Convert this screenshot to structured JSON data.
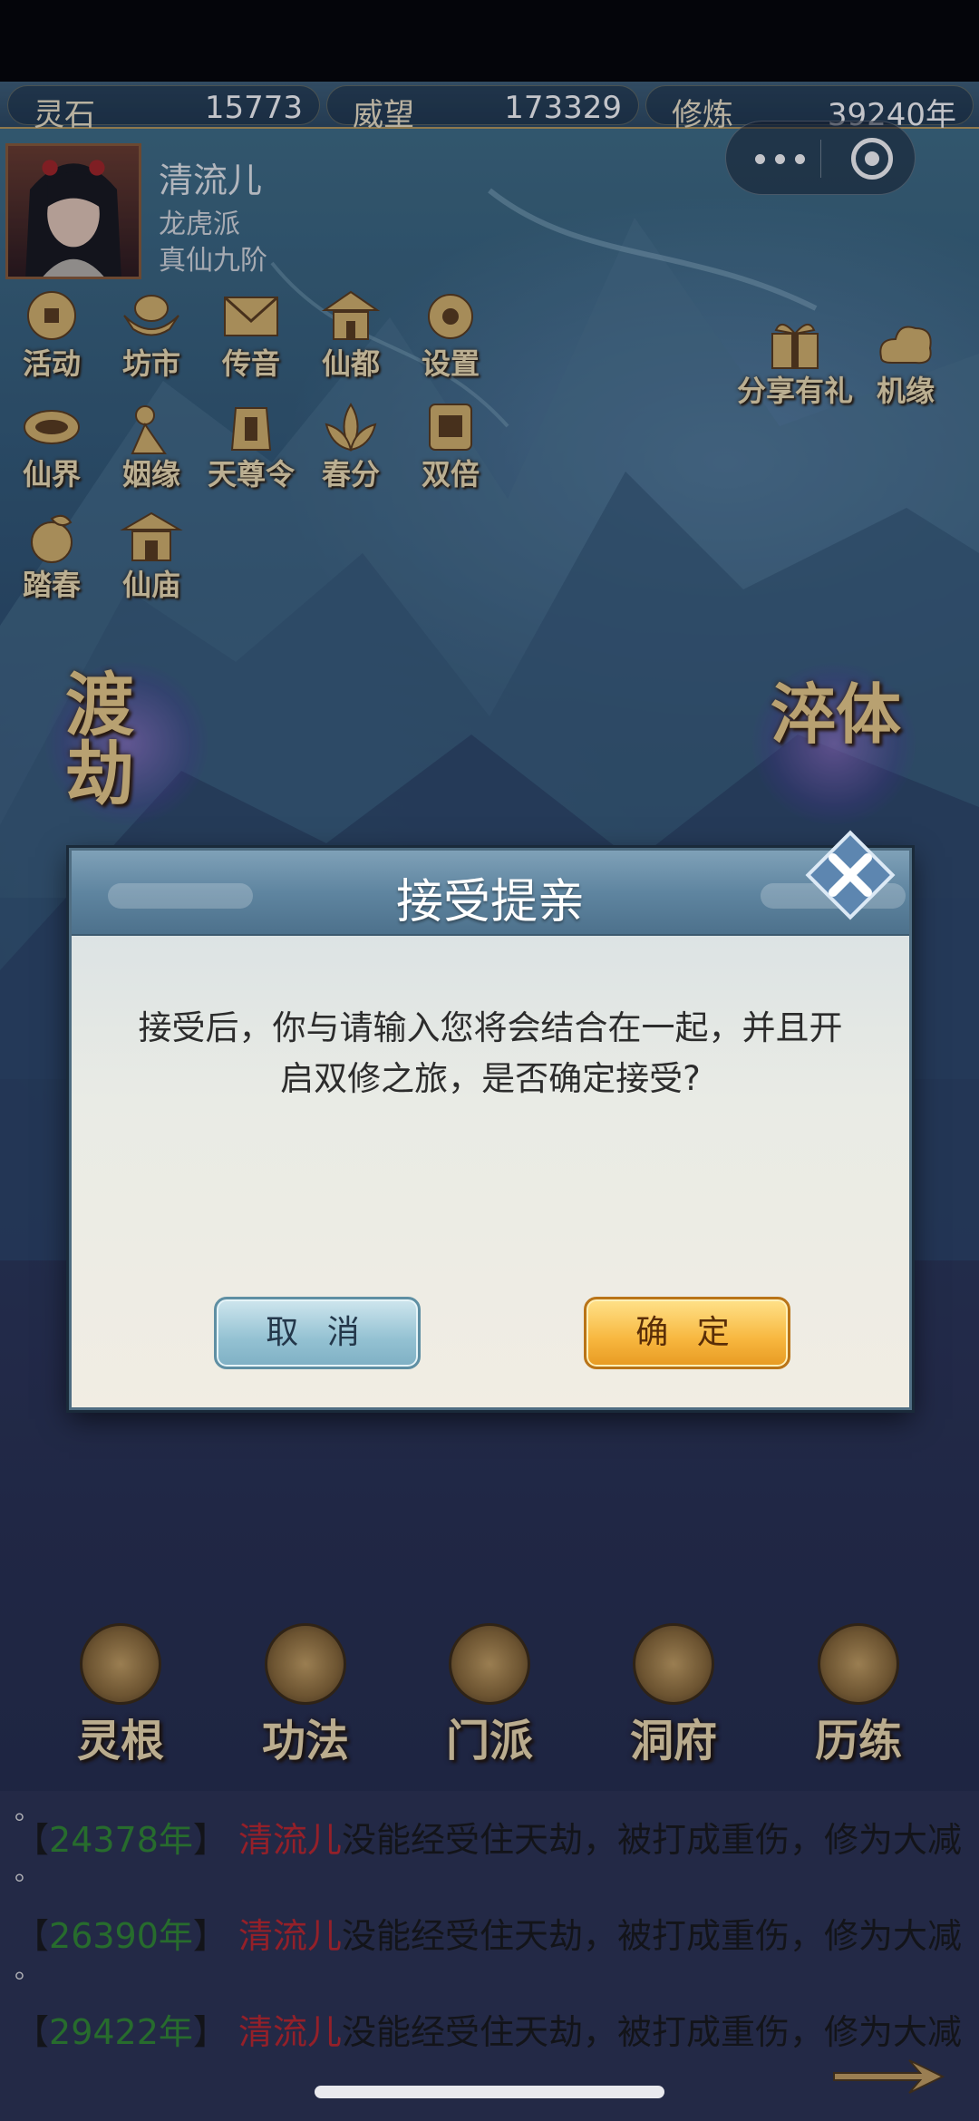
{
  "resources": {
    "spirit_stone_label": "灵石",
    "spirit_stone_value": "15773",
    "prestige_label": "威望",
    "prestige_value": "173329",
    "cultivation_label": "修炼",
    "cultivation_value": "39240年"
  },
  "profile": {
    "name": "清流儿",
    "sect": "龙虎派",
    "rank": "真仙九阶"
  },
  "menu_row1": [
    "活动",
    "坊市",
    "传音",
    "仙都",
    "设置"
  ],
  "menu_row2": [
    "仙界",
    "姻缘",
    "天尊令",
    "春分",
    "双倍"
  ],
  "menu_row3": [
    "踏春",
    "仙庙"
  ],
  "right_menu": [
    "分享有礼",
    "机缘"
  ],
  "big_actions": {
    "left": "渡劫",
    "right": "淬体"
  },
  "dialog": {
    "title": "接受提亲",
    "message": "接受后，你与请输入您将会结合在一起，并且开启双修之旅，是否确定接受?",
    "cancel": "取 消",
    "confirm": "确 定"
  },
  "bottom_nav": [
    "灵根",
    "功法",
    "门派",
    "洞府",
    "历练"
  ],
  "log": [
    {
      "prefix": "【",
      "year": "24378年",
      "suffix": "】",
      "name": "清流儿",
      "text": "没能经受住天劫，被打成重伤，修为大减"
    },
    {
      "prefix": "【",
      "year": "26390年",
      "suffix": "】",
      "name": "清流儿",
      "text": "没能经受住天劫，被打成重伤，修为大减"
    },
    {
      "prefix": "【",
      "year": "29422年",
      "suffix": "】",
      "name": "清流儿",
      "text": "没能经受住天劫，被打成重伤，修为大减"
    }
  ],
  "log_dots": [
    "。",
    "。",
    "。"
  ],
  "colors": {
    "accent_gold": "#d9b46a",
    "confirm_orange": "#f7b63e",
    "cancel_blue": "#93c1d2",
    "log_year_green": "#2f8a2f",
    "log_name_red": "#c0252a"
  }
}
